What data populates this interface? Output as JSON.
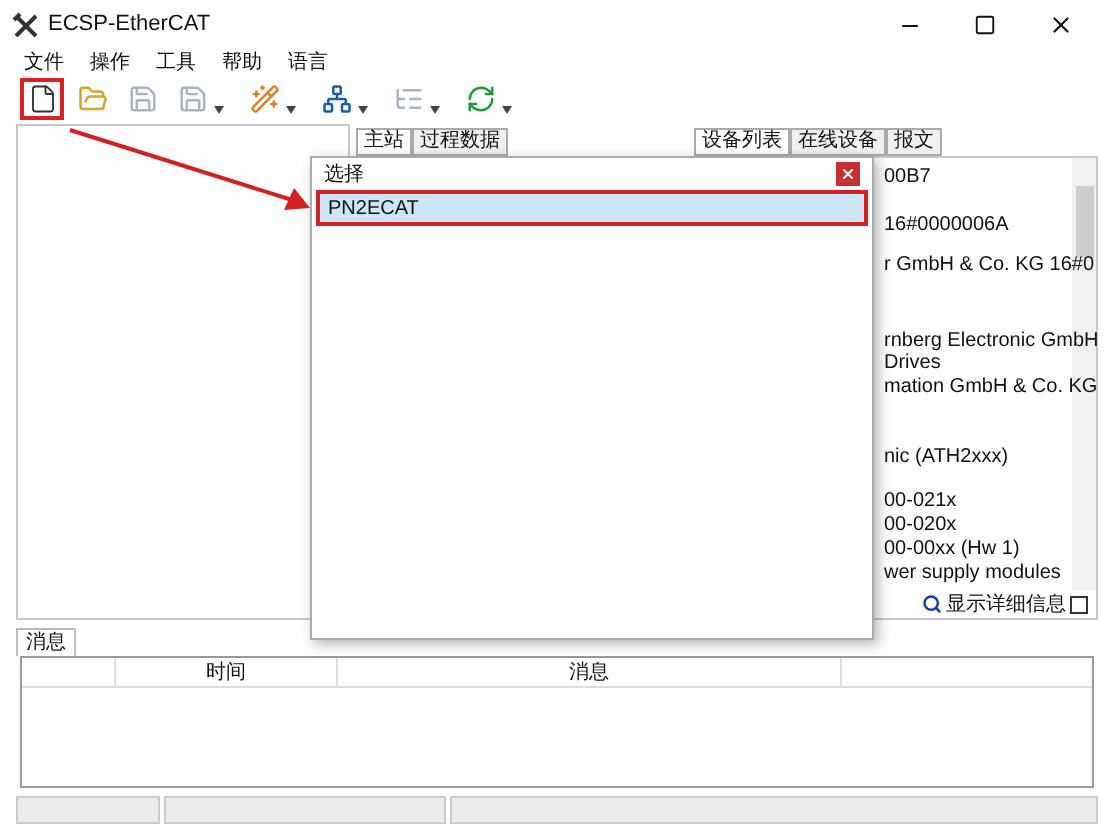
{
  "window": {
    "title": "ECSP-EtherCAT"
  },
  "menu": [
    {
      "label": "文件"
    },
    {
      "label": "操作"
    },
    {
      "label": "工具"
    },
    {
      "label": "帮助"
    },
    {
      "label": "语言"
    }
  ],
  "toolbar": [
    {
      "kind": "new",
      "disabled": false,
      "highlighted": true
    },
    {
      "kind": "open",
      "disabled": false,
      "highlighted": false
    },
    {
      "kind": "save",
      "disabled": true,
      "highlighted": false
    },
    {
      "kind": "saveas",
      "disabled": true,
      "highlighted": false,
      "dropdown": true
    },
    {
      "kind": "config",
      "disabled": false,
      "highlighted": false,
      "dropdown": true
    },
    {
      "kind": "network",
      "disabled": false,
      "highlighted": false,
      "dropdown": true
    },
    {
      "kind": "list",
      "disabled": true,
      "highlighted": false,
      "dropdown": true
    },
    {
      "kind": "refresh",
      "disabled": false,
      "highlighted": false,
      "dropdown": true
    }
  ],
  "middle_tabs": [
    {
      "label": "主站",
      "selected": true
    },
    {
      "label": "过程数据",
      "selected": false
    }
  ],
  "right_tabs": [
    {
      "label": "设备列表",
      "selected": true
    },
    {
      "label": "在线设备",
      "selected": false
    },
    {
      "label": "报文",
      "selected": false
    }
  ],
  "device_list": [
    {
      "text": "00B7"
    },
    {
      "text": "16#0000006A"
    },
    {
      "text": "r GmbH & Co. KG   16#0"
    },
    {
      "text": "rnberg Electronic GmbH"
    },
    {
      "text": "Drives"
    },
    {
      "text": "mation GmbH & Co. KG"
    },
    {
      "text": "nic (ATH2xxx)"
    },
    {
      "text": "00-021x"
    },
    {
      "text": "00-020x"
    },
    {
      "text": "00-00xx (Hw 1)"
    },
    {
      "text": "wer supply modules"
    }
  ],
  "show_details": {
    "label": "显示详细信息",
    "checked": false
  },
  "dialog": {
    "title": "选择",
    "items": [
      {
        "label": "PN2ECAT",
        "selected": true
      }
    ]
  },
  "messages": {
    "tab": "消息",
    "columns": [
      {
        "label": "时间"
      },
      {
        "label": "消息"
      }
    ]
  }
}
